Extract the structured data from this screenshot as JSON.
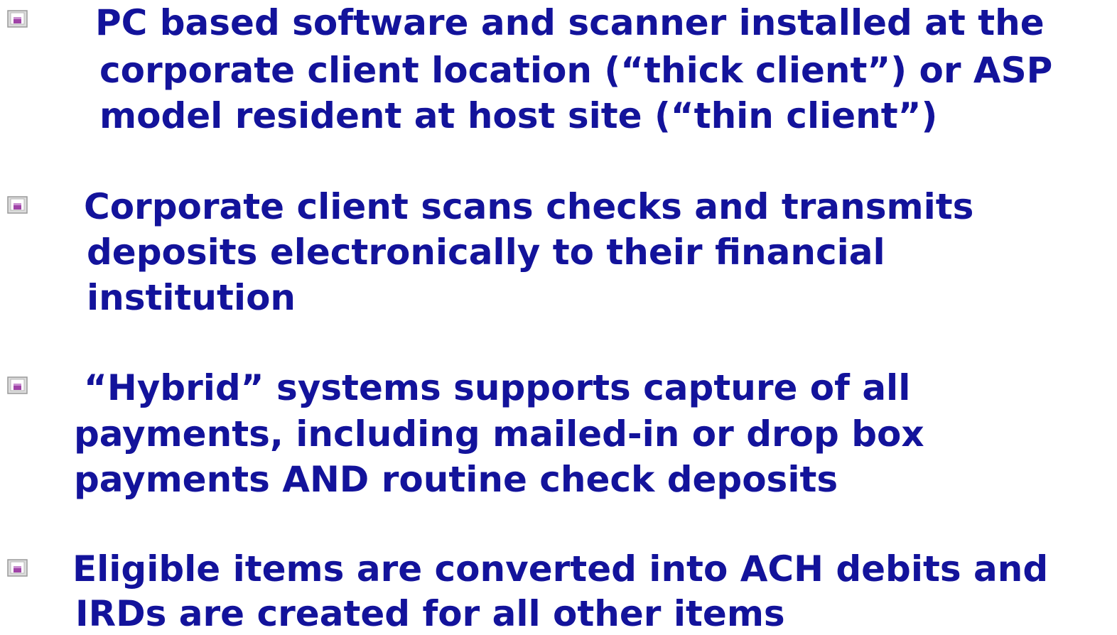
{
  "text_color": "#13139b",
  "bullet_icon": "framed-square-bullet-icon",
  "bullets": [
    {
      "lines": [
        "PC based software and scanner installed at the",
        "corporate client location (“thick client”) or ASP",
        "model resident at host site (“thin client”)"
      ]
    },
    {
      "lines": [
        "Corporate client scans checks and transmits",
        "deposits electronically to their financial",
        "institution"
      ]
    },
    {
      "lines": [
        "“Hybrid” systems supports capture of all",
        "payments, including mailed-in or drop box",
        "payments AND routine check deposits"
      ]
    },
    {
      "lines": [
        "Eligible items are converted into ACH debits and",
        "IRDs are created for all other items"
      ]
    }
  ]
}
